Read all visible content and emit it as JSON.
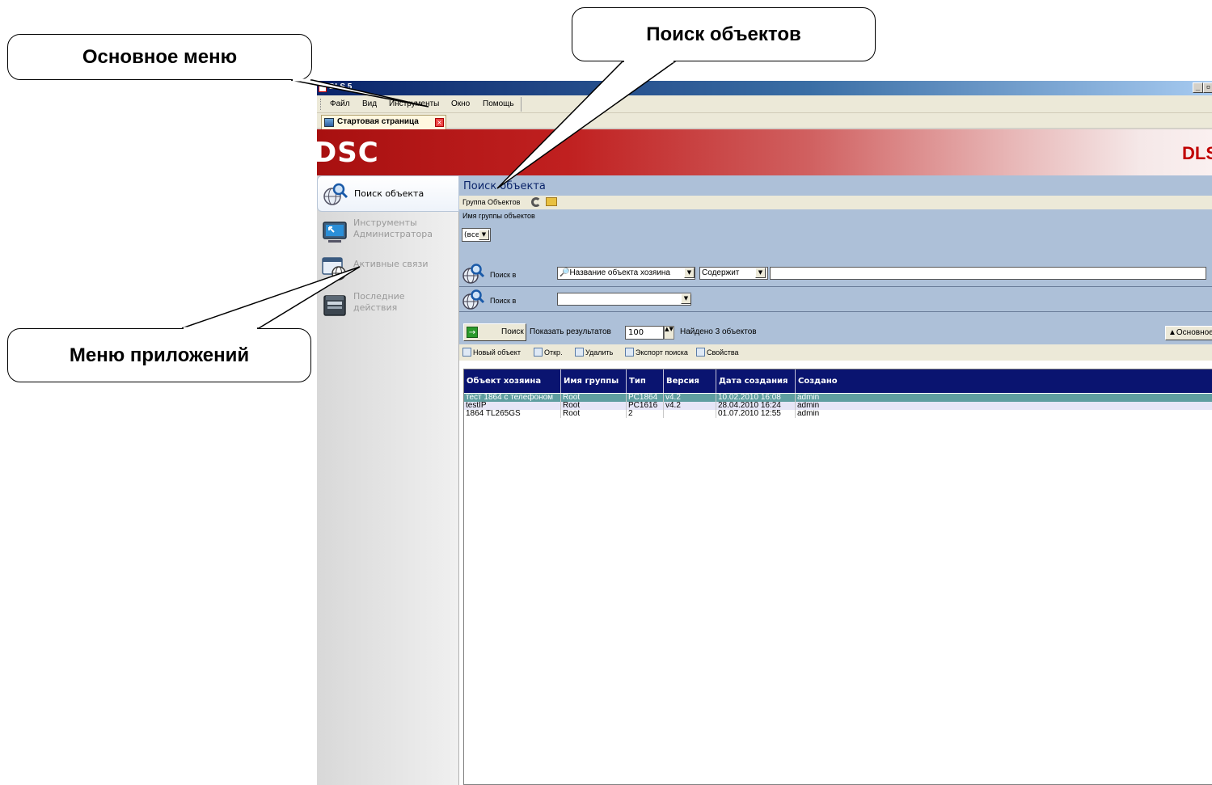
{
  "window": {
    "title": "DLS 5",
    "minimize_glyph": "_",
    "restore_glyph": "▫"
  },
  "menu": {
    "items": [
      "Файл",
      "Вид",
      "Инструменты",
      "Окно",
      "Помощь"
    ]
  },
  "tabs": [
    {
      "label": "Стартовая страница",
      "close_glyph": "×"
    }
  ],
  "banner": {
    "brand": "DSC",
    "product": "DLS-"
  },
  "sidebar": {
    "items": [
      {
        "label_line1": "Поиск объекта",
        "label_line2": "",
        "active": true,
        "icon": "globe-search-icon"
      },
      {
        "label_line1": "Инструменты",
        "label_line2": "Администратора",
        "active": false,
        "icon": "monitor-icon"
      },
      {
        "label_line1": "Активные связи",
        "label_line2": "",
        "active": false,
        "icon": "window-globe-icon"
      },
      {
        "label_line1": "Последние",
        "label_line2": "действия",
        "active": false,
        "icon": "file-box-icon"
      }
    ]
  },
  "search": {
    "title": "Поиск объекта",
    "group_toolbar_label": "Группа Объектов",
    "group_name_label": "Имя группы объектов",
    "group_select_value": "(все",
    "row1": {
      "label": "Поиск в",
      "field_value": "Название объекта хозяина",
      "condition_value": "Содержит",
      "text_value": ""
    },
    "row2": {
      "label": "Поиск в",
      "field_value": ""
    },
    "find_button": "Поиск",
    "show_results_label": "Показать результатов",
    "results_count": "100",
    "found_label": "Найдено 3 объектов",
    "main_button": "Основное",
    "arrow_glyph": "→",
    "spin_glyph": "▲▼",
    "dropdown_glyph": "▼"
  },
  "actions": {
    "new_object": "Новый объект",
    "open": "Откр.",
    "delete": "Удалить",
    "export_search": "Экспорт поиска",
    "properties": "Свойства"
  },
  "grid": {
    "columns": [
      "Объект хозяина",
      "Имя группы",
      "Тип",
      "Версия",
      "Дата создания",
      "Создано"
    ],
    "rows": [
      [
        "тест 1864 с телефоном",
        "Root",
        "PC1864",
        "v4.2",
        "10.02.2010 16:08",
        "admin"
      ],
      [
        "testIP",
        "Root",
        "PC1616",
        "v4.2",
        "28.04.2010 16:24",
        "admin"
      ],
      [
        "1864 TL265GS",
        "Root",
        "2",
        "",
        "01.07.2010 12:55",
        "admin"
      ]
    ]
  },
  "callouts": {
    "main_menu": "Основное меню",
    "object_search": "Поиск объектов",
    "app_menu": "Меню приложений"
  },
  "colors": {
    "brand_red": "#c02020",
    "grid_header": "#0a1470",
    "selected_row": "#5f9ea0",
    "search_panel": "#adc0d8"
  }
}
